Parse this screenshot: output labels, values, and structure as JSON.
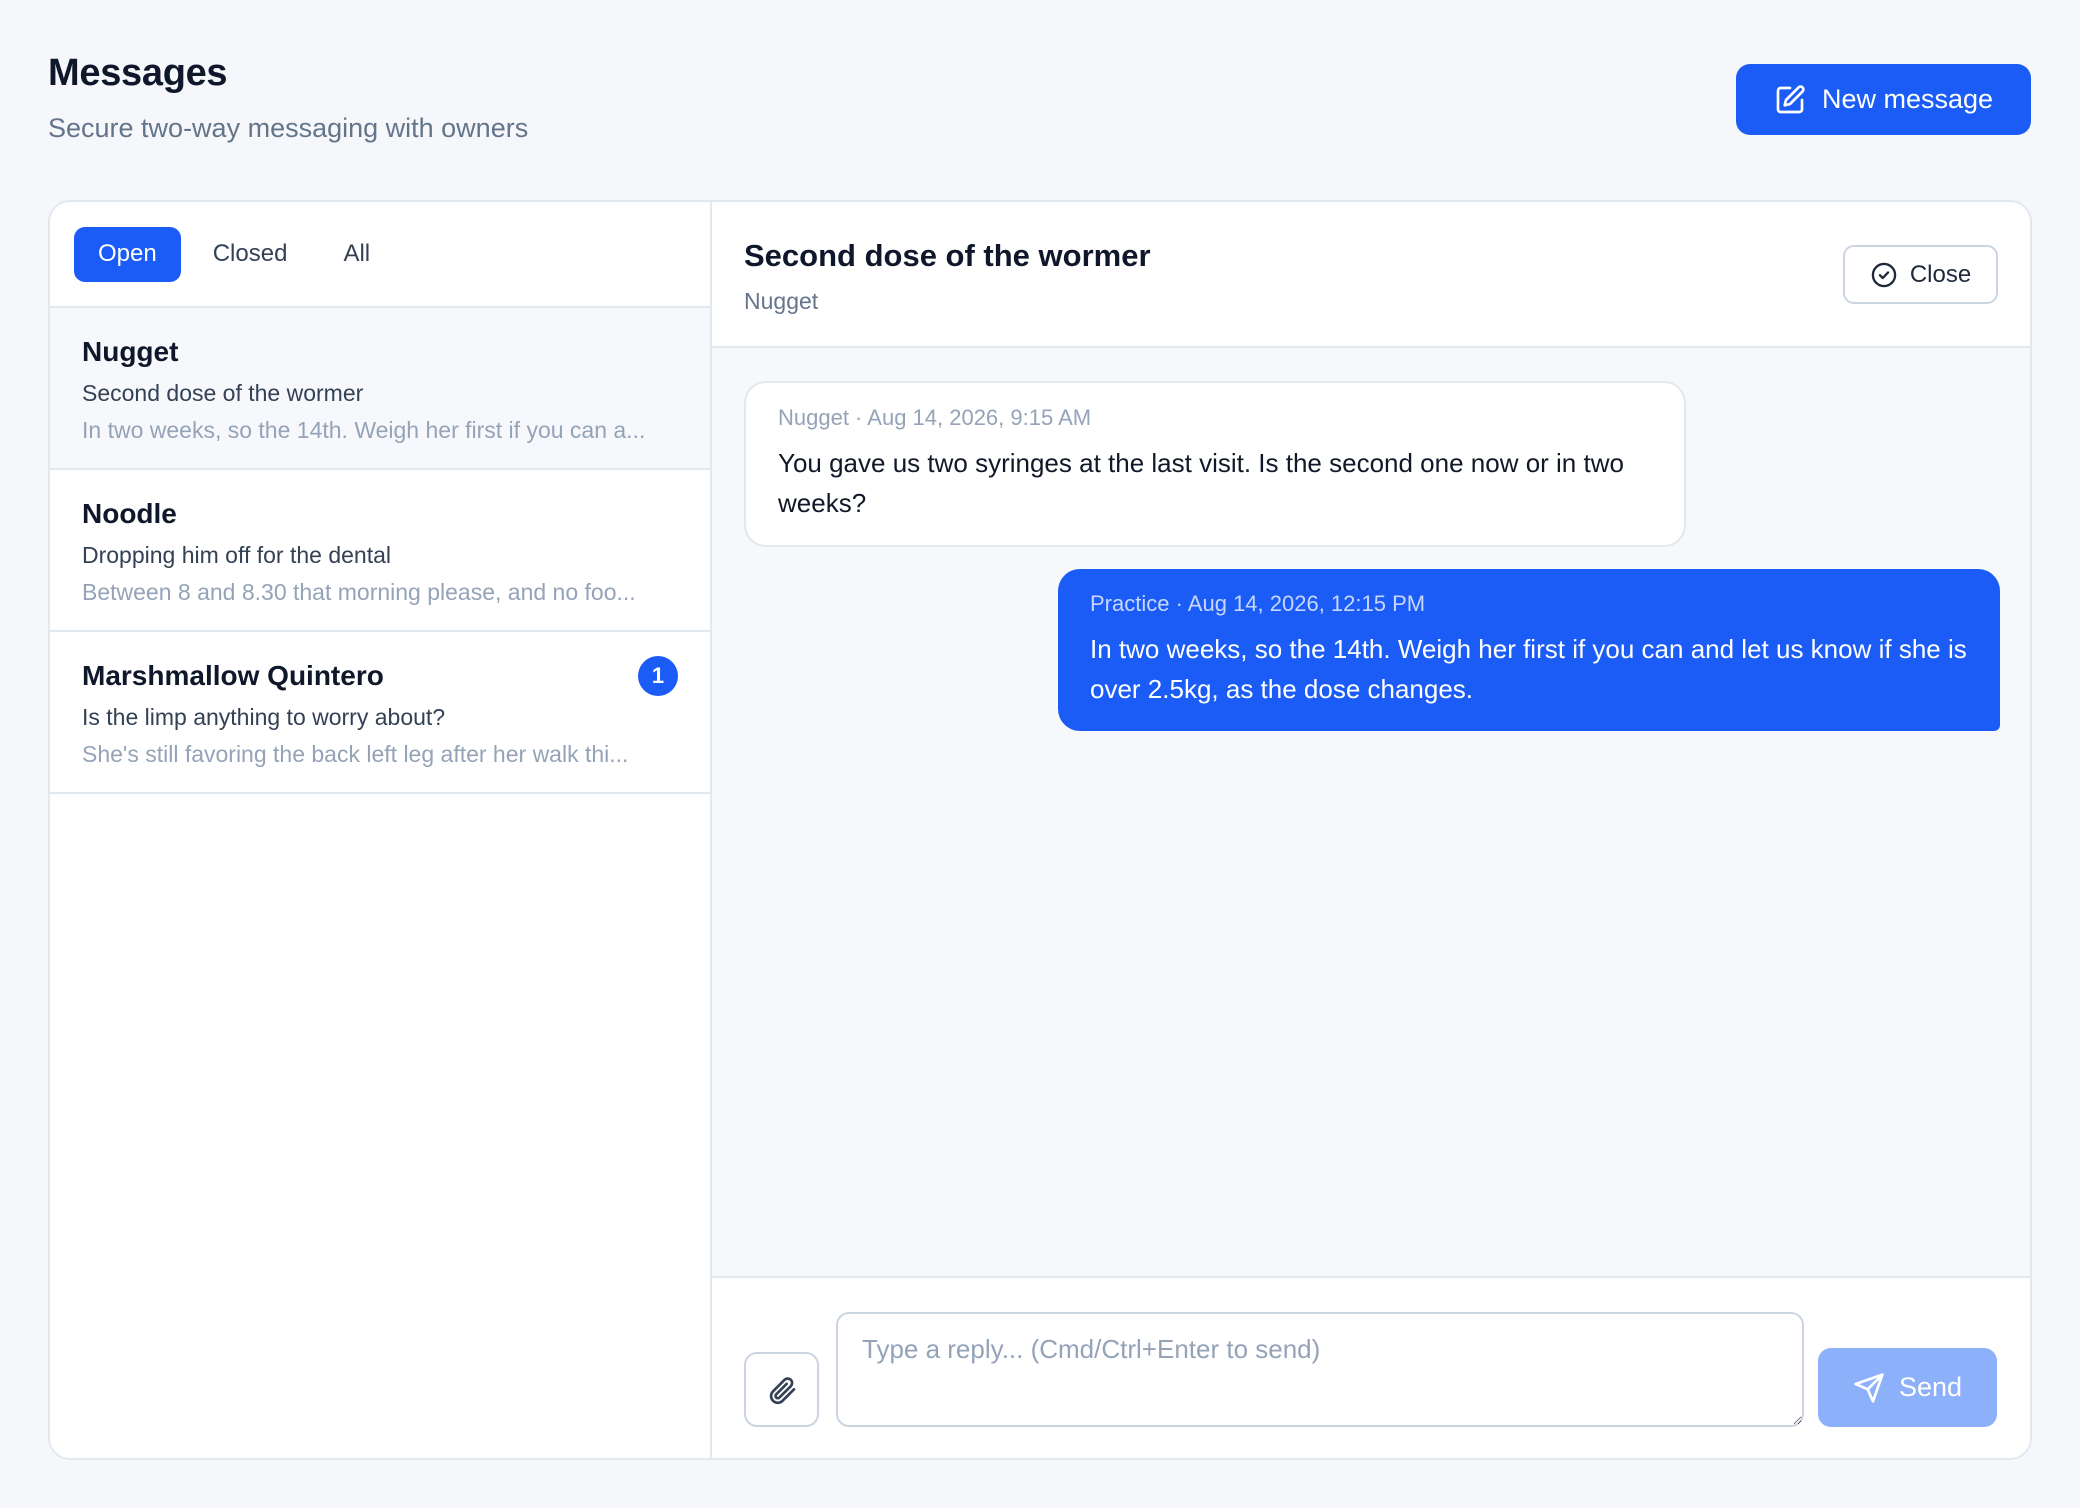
{
  "header": {
    "title": "Messages",
    "subtitle": "Secure two-way messaging with owners",
    "new_message_label": "New message",
    "new_message_icon": "pencil-square-icon"
  },
  "tabs": [
    {
      "label": "Open",
      "active": true
    },
    {
      "label": "Closed",
      "active": false
    },
    {
      "label": "All",
      "active": false
    }
  ],
  "conversations": [
    {
      "name": "Nugget",
      "subject": "Second dose of the wormer",
      "preview": "In two weeks, so the 14th. Weigh her first if you can a...",
      "unread": "",
      "selected": true
    },
    {
      "name": "Noodle",
      "subject": "Dropping him off for the dental",
      "preview": "Between 8 and 8.30 that morning please, and no foo...",
      "unread": "",
      "selected": false
    },
    {
      "name": "Marshmallow Quintero",
      "subject": "Is the limp anything to worry about?",
      "preview": "She's still favoring the back left leg after her walk thi...",
      "unread": "1",
      "selected": false
    }
  ],
  "thread": {
    "title": "Second dose of the wormer",
    "pet": "Nugget",
    "close_label": "Close",
    "close_icon": "check-circle-icon",
    "messages": [
      {
        "direction": "in",
        "meta": "Nugget · Aug 14, 2026, 9:15 AM",
        "text": "You gave us two syringes at the last visit. Is the second one now or in two weeks?"
      },
      {
        "direction": "out",
        "meta": "Practice · Aug 14, 2026, 12:15 PM",
        "text": "In two weeks, so the 14th. Weigh her first if you can and let us know if she is over 2.5kg, as the dose changes."
      }
    ]
  },
  "composer": {
    "placeholder": "Type a reply... (Cmd/Ctrl+Enter to send)",
    "value": "",
    "send_label": "Send",
    "attach_icon": "paperclip-icon",
    "send_icon": "send-icon"
  },
  "colors": {
    "accent": "#1a5cf5",
    "accent_disabled": "#8db0fb",
    "background": "#f5f7fa",
    "border": "#e2e8f0"
  }
}
